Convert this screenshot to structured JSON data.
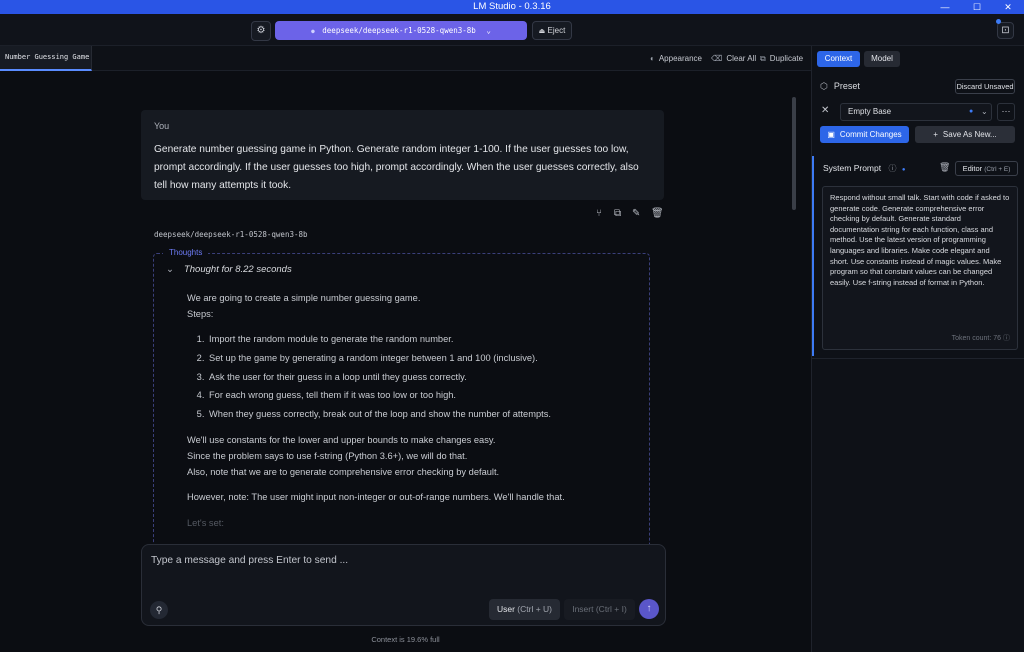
{
  "window": {
    "title": "LM Studio - 0.3.16",
    "minimize": "—",
    "maximize": "☐",
    "close": "✕"
  },
  "topbar": {
    "settings_icon": "⚙",
    "model_name": "deepseek/deepseek-r1-0528-qwen3-8b",
    "model_icon": "●",
    "model_chevron": "⌄",
    "eject_label": "Eject",
    "eject_icon": "⏏",
    "panel_toggle_icon": "⊡"
  },
  "tabbar": {
    "active_tab": "Number Guessing Game",
    "appearance_label": "Appearance",
    "clear_all_label": "Clear All",
    "duplicate_label": "Duplicate"
  },
  "chat": {
    "user_message": {
      "author": "You",
      "text": "Generate number guessing game in Python. Generate random integer 1-100. If the user guesses too low, prompt accordingly. If the user guesses too high, prompt accordingly. When the user guesses correctly, also tell how many attempts it took."
    },
    "bot_name": "deepseek/deepseek-r1-0528-qwen3-8b",
    "thoughts_label": "Thoughts",
    "thought_header": "Thought for 8.22 seconds",
    "thought_intro": "We are going to create a simple number guessing game.",
    "thought_steps_label": "Steps:",
    "thought_steps": [
      "Import the random module to generate the random number.",
      "Set up the game by generating a random integer between 1 and 100 (inclusive).",
      "Ask the user for their guess in a loop until they guess correctly.",
      "For each wrong guess, tell them if it was too low or too high.",
      "When they guess correctly, break out of the loop and show the number of attempts."
    ],
    "thought_line_1": "We'll use constants for the lower and upper bounds to make changes easy.",
    "thought_line_2": "Since the problem says to use f-string (Python 3.6+), we will do that.",
    "thought_line_3": "Also, note that we are to generate comprehensive error checking by default.",
    "thought_note": "However, note: The user might input non-integer or out-of-range numbers. We'll handle that.",
    "thought_faded": "Let's set:"
  },
  "composer": {
    "placeholder": "Type a message and press Enter to send ...",
    "attach_icon": "📎",
    "user_button": "User",
    "user_shortcut": "(Ctrl + U)",
    "insert_button": "Insert",
    "insert_shortcut": "(Ctrl + I)",
    "send_icon": "↑",
    "context_status": "Context is 19.6% full"
  },
  "sidebar": {
    "tab_context": "Context",
    "tab_model": "Model",
    "preset_label": "Preset",
    "discard_label": "Discard Unsaved",
    "preset_value": "Empty Base",
    "commit_label": "Commit Changes",
    "save_as_label": "Save As New...",
    "system_prompt_label": "System Prompt",
    "editor_label": "Editor",
    "editor_shortcut": "(Ctrl + E)",
    "system_prompt_text": "Respond without small talk. Start with code if asked to generate code. Generate comprehensive error checking by default. Generate standard documentation string for each function, class and method. Use the latest version of programming languages and libraries. Make code elegant and short. Use constants instead of magic values. Make program so that constant values can be changed easily. Use f-string instead of format in Python.",
    "token_count": "Token count: 76"
  },
  "colors": {
    "accent_blue": "#2d66e8",
    "model_purple": "#6c63e8",
    "titlebar_blue": "#2a55e6"
  }
}
